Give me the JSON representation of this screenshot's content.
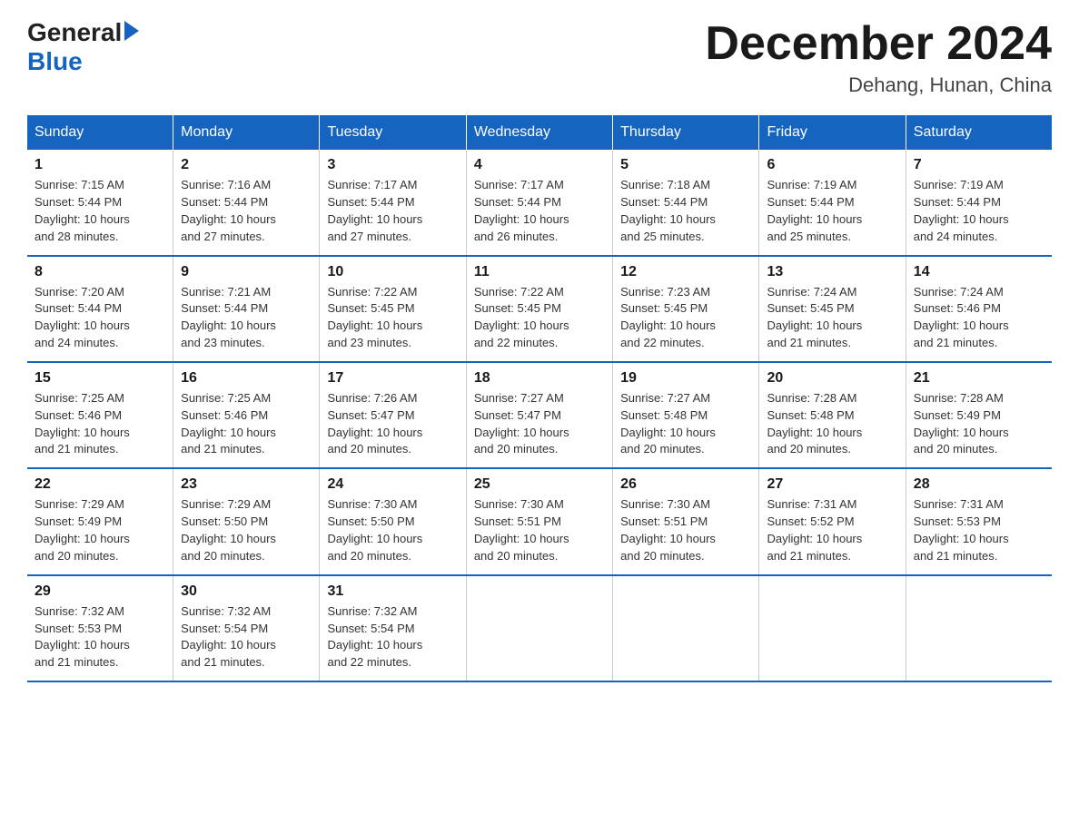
{
  "logo": {
    "general": "General",
    "blue": "Blue"
  },
  "title": "December 2024",
  "subtitle": "Dehang, Hunan, China",
  "days_header": [
    "Sunday",
    "Monday",
    "Tuesday",
    "Wednesday",
    "Thursday",
    "Friday",
    "Saturday"
  ],
  "weeks": [
    [
      {
        "num": "1",
        "sunrise": "7:15 AM",
        "sunset": "5:44 PM",
        "daylight": "10 hours and 28 minutes."
      },
      {
        "num": "2",
        "sunrise": "7:16 AM",
        "sunset": "5:44 PM",
        "daylight": "10 hours and 27 minutes."
      },
      {
        "num": "3",
        "sunrise": "7:17 AM",
        "sunset": "5:44 PM",
        "daylight": "10 hours and 27 minutes."
      },
      {
        "num": "4",
        "sunrise": "7:17 AM",
        "sunset": "5:44 PM",
        "daylight": "10 hours and 26 minutes."
      },
      {
        "num": "5",
        "sunrise": "7:18 AM",
        "sunset": "5:44 PM",
        "daylight": "10 hours and 25 minutes."
      },
      {
        "num": "6",
        "sunrise": "7:19 AM",
        "sunset": "5:44 PM",
        "daylight": "10 hours and 25 minutes."
      },
      {
        "num": "7",
        "sunrise": "7:19 AM",
        "sunset": "5:44 PM",
        "daylight": "10 hours and 24 minutes."
      }
    ],
    [
      {
        "num": "8",
        "sunrise": "7:20 AM",
        "sunset": "5:44 PM",
        "daylight": "10 hours and 24 minutes."
      },
      {
        "num": "9",
        "sunrise": "7:21 AM",
        "sunset": "5:44 PM",
        "daylight": "10 hours and 23 minutes."
      },
      {
        "num": "10",
        "sunrise": "7:22 AM",
        "sunset": "5:45 PM",
        "daylight": "10 hours and 23 minutes."
      },
      {
        "num": "11",
        "sunrise": "7:22 AM",
        "sunset": "5:45 PM",
        "daylight": "10 hours and 22 minutes."
      },
      {
        "num": "12",
        "sunrise": "7:23 AM",
        "sunset": "5:45 PM",
        "daylight": "10 hours and 22 minutes."
      },
      {
        "num": "13",
        "sunrise": "7:24 AM",
        "sunset": "5:45 PM",
        "daylight": "10 hours and 21 minutes."
      },
      {
        "num": "14",
        "sunrise": "7:24 AM",
        "sunset": "5:46 PM",
        "daylight": "10 hours and 21 minutes."
      }
    ],
    [
      {
        "num": "15",
        "sunrise": "7:25 AM",
        "sunset": "5:46 PM",
        "daylight": "10 hours and 21 minutes."
      },
      {
        "num": "16",
        "sunrise": "7:25 AM",
        "sunset": "5:46 PM",
        "daylight": "10 hours and 21 minutes."
      },
      {
        "num": "17",
        "sunrise": "7:26 AM",
        "sunset": "5:47 PM",
        "daylight": "10 hours and 20 minutes."
      },
      {
        "num": "18",
        "sunrise": "7:27 AM",
        "sunset": "5:47 PM",
        "daylight": "10 hours and 20 minutes."
      },
      {
        "num": "19",
        "sunrise": "7:27 AM",
        "sunset": "5:48 PM",
        "daylight": "10 hours and 20 minutes."
      },
      {
        "num": "20",
        "sunrise": "7:28 AM",
        "sunset": "5:48 PM",
        "daylight": "10 hours and 20 minutes."
      },
      {
        "num": "21",
        "sunrise": "7:28 AM",
        "sunset": "5:49 PM",
        "daylight": "10 hours and 20 minutes."
      }
    ],
    [
      {
        "num": "22",
        "sunrise": "7:29 AM",
        "sunset": "5:49 PM",
        "daylight": "10 hours and 20 minutes."
      },
      {
        "num": "23",
        "sunrise": "7:29 AM",
        "sunset": "5:50 PM",
        "daylight": "10 hours and 20 minutes."
      },
      {
        "num": "24",
        "sunrise": "7:30 AM",
        "sunset": "5:50 PM",
        "daylight": "10 hours and 20 minutes."
      },
      {
        "num": "25",
        "sunrise": "7:30 AM",
        "sunset": "5:51 PM",
        "daylight": "10 hours and 20 minutes."
      },
      {
        "num": "26",
        "sunrise": "7:30 AM",
        "sunset": "5:51 PM",
        "daylight": "10 hours and 20 minutes."
      },
      {
        "num": "27",
        "sunrise": "7:31 AM",
        "sunset": "5:52 PM",
        "daylight": "10 hours and 21 minutes."
      },
      {
        "num": "28",
        "sunrise": "7:31 AM",
        "sunset": "5:53 PM",
        "daylight": "10 hours and 21 minutes."
      }
    ],
    [
      {
        "num": "29",
        "sunrise": "7:32 AM",
        "sunset": "5:53 PM",
        "daylight": "10 hours and 21 minutes."
      },
      {
        "num": "30",
        "sunrise": "7:32 AM",
        "sunset": "5:54 PM",
        "daylight": "10 hours and 21 minutes."
      },
      {
        "num": "31",
        "sunrise": "7:32 AM",
        "sunset": "5:54 PM",
        "daylight": "10 hours and 22 minutes."
      },
      null,
      null,
      null,
      null
    ]
  ],
  "labels": {
    "sunrise": "Sunrise:",
    "sunset": "Sunset:",
    "daylight": "Daylight:"
  }
}
